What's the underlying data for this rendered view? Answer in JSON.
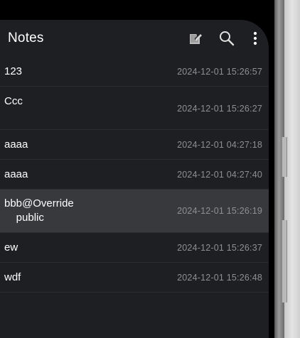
{
  "app": {
    "title": "Notes"
  },
  "toolbar": {
    "icons": [
      "edit-note-icon",
      "search-icon",
      "more-vert-icon"
    ]
  },
  "notes": [
    {
      "title": "123",
      "time": "2024-12-01 15:26:57",
      "selected": false
    },
    {
      "title": "Ccc",
      "time": "2024-12-01 15:26:27",
      "selected": false
    },
    {
      "title": "aaaa",
      "time": "2024-12-01 04:27:18",
      "selected": false
    },
    {
      "title": "aaaa",
      "time": "2024-12-01 04:27:40",
      "selected": false
    },
    {
      "title": "bbb@Override\n    public",
      "time": "2024-12-01 15:26:19",
      "selected": true
    },
    {
      "title": "ew",
      "time": "2024-12-01 15:26:37",
      "selected": false
    },
    {
      "title": "wdf",
      "time": "2024-12-01 15:26:48",
      "selected": false
    }
  ],
  "colors": {
    "background": "#1e1f23",
    "selected_row": "#38393d",
    "title_text": "#ffffff",
    "time_text": "#8e8f93"
  }
}
